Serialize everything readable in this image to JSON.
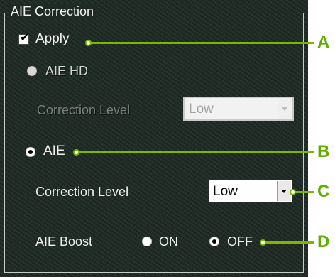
{
  "group": {
    "title": "AIE Correction"
  },
  "apply": {
    "label": "Apply",
    "checked": true
  },
  "aie_hd": {
    "label": "AIE HD",
    "correction_level_label": "Correction Level",
    "correction_level_value": "Low"
  },
  "aie": {
    "label": "AIE",
    "correction_level_label": "Correction Level",
    "correction_level_value": "Low"
  },
  "boost": {
    "label": "AIE Boost",
    "on_label": "ON",
    "off_label": "OFF",
    "selected": "OFF"
  },
  "callouts": {
    "a": "A",
    "b": "B",
    "c": "C",
    "d": "D"
  },
  "colors": {
    "panel_bg": "#1f2a24",
    "callout_green": "#7ab800",
    "text": "#f0f0f0",
    "disabled_text": "#7c837e"
  },
  "icons": {
    "checkbox": "check-icon",
    "dropdown": "chevron-down-icon"
  }
}
